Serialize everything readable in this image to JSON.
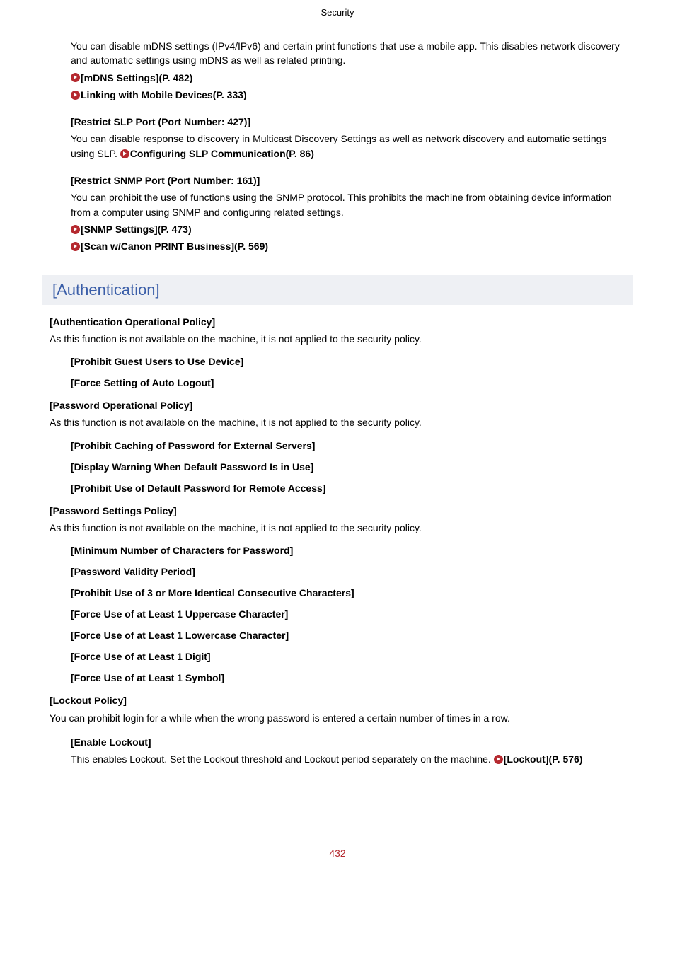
{
  "header": {
    "title": "Security"
  },
  "intro": {
    "text": "You can disable mDNS settings (IPv4/IPv6) and certain print functions that use a mobile app. This disables network discovery and automatic settings using mDNS as well as related printing.",
    "link1": "[mDNS Settings](P. 482)",
    "link2": "Linking with Mobile Devices(P. 333)"
  },
  "slp": {
    "heading": "[Restrict SLP Port (Port Number: 427)]",
    "text_a": "You can disable response to discovery in Multicast Discovery Settings as well as network discovery and automatic settings using SLP. ",
    "link": "Configuring SLP Communication(P. 86)"
  },
  "snmp": {
    "heading": "[Restrict SNMP Port (Port Number: 161)]",
    "text": "You can prohibit the use of functions using the SNMP protocol. This prohibits the machine from obtaining device information from a computer using SNMP and configuring related settings.",
    "link1": "[SNMP Settings](P. 473)",
    "link2": "[Scan w/Canon PRINT Business](P. 569)"
  },
  "section": {
    "title": "[Authentication]"
  },
  "auth_op": {
    "heading": "[Authentication Operational Policy]",
    "text": "As this function is not available on the machine, it is not applied to the security policy.",
    "item1": "[Prohibit Guest Users to Use Device]",
    "item2": "[Force Setting of Auto Logout]"
  },
  "pwd_op": {
    "heading": "[Password Operational Policy]",
    "text": "As this function is not available on the machine, it is not applied to the security policy.",
    "item1": "[Prohibit Caching of Password for External Servers]",
    "item2": "[Display Warning When Default Password Is in Use]",
    "item3": "[Prohibit Use of Default Password for Remote Access]"
  },
  "pwd_set": {
    "heading": "[Password Settings Policy]",
    "text": "As this function is not available on the machine, it is not applied to the security policy.",
    "item1": "[Minimum Number of Characters for Password]",
    "item2": "[Password Validity Period]",
    "item3": "[Prohibit Use of 3 or More Identical Consecutive Characters]",
    "item4": "[Force Use of at Least 1 Uppercase Character]",
    "item5": "[Force Use of at Least 1 Lowercase Character]",
    "item6": "[Force Use of at Least 1 Digit]",
    "item7": "[Force Use of at Least 1 Symbol]"
  },
  "lockout": {
    "heading": "[Lockout Policy]",
    "text": "You can prohibit login for a while when the wrong password is entered a certain number of times in a row.",
    "sub_heading": "[Enable Lockout]",
    "sub_text_a": "This enables Lockout. Set the Lockout threshold and Lockout period separately on the machine. ",
    "sub_link": "[Lockout](P. 576)"
  },
  "footer": {
    "page": "432"
  }
}
